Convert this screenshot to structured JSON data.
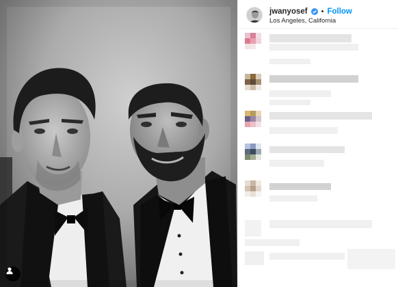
{
  "post": {
    "photo_alt": "",
    "photo_style": "black-and-white",
    "tag_icon": "user-tag-icon"
  },
  "header": {
    "username": "jwanyosef",
    "verified_icon": "verified-badge-icon",
    "separator": "•",
    "follow_label": "Follow",
    "location": "Los Angeles, California",
    "accent_color": "#0095f6"
  },
  "comments": {
    "state": "pixelated",
    "count": 7
  }
}
